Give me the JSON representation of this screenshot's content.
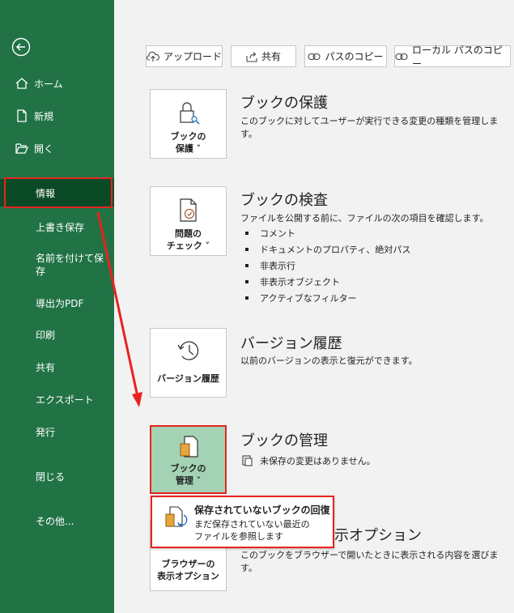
{
  "sidebar": {
    "items": [
      {
        "label": "ホーム",
        "icon": "home-icon"
      },
      {
        "label": "新規",
        "icon": "new-file-icon"
      },
      {
        "label": "開く",
        "icon": "folder-open-icon"
      },
      {
        "label": "情報",
        "selected": true
      },
      {
        "label": "上書き保存"
      },
      {
        "label": "名前を付けて保存"
      },
      {
        "label": "導出为PDF"
      },
      {
        "label": "印刷"
      },
      {
        "label": "共有"
      },
      {
        "label": "エクスポート"
      },
      {
        "label": "発行"
      },
      {
        "label": "閉じる"
      },
      {
        "label": "その他..."
      }
    ]
  },
  "toolbar": {
    "upload": "アップロード",
    "share": "共有",
    "copy_path": "パスのコピー",
    "copy_local_path": "ローカル パスのコピー"
  },
  "protect": {
    "tile_line1": "ブックの",
    "tile_line2": "保護 ˅",
    "title": "ブックの保護",
    "desc": "このブックに対してユーザーが実行できる変更の種類を管理します。"
  },
  "inspect": {
    "tile_line1": "問題の",
    "tile_line2": "チェック ˅",
    "title": "ブックの検査",
    "desc": "ファイルを公開する前に、ファイルの次の項目を確認します。",
    "bullets": [
      "コメント",
      "ドキュメントのプロパティ、絶対パス",
      "非表示行",
      "非表示オブジェクト",
      "アクティブなフィルター"
    ]
  },
  "version": {
    "tile_line1": "バージョン履歴",
    "title": "バージョン履歴",
    "desc": "以前のバージョンの表示と復元ができます。"
  },
  "manage": {
    "tile_line1": "ブックの",
    "tile_line2": "管理 ˅",
    "title": "ブックの管理",
    "status": "未保存の変更はありません。"
  },
  "browser": {
    "tile_line1": "ブラウザーの",
    "tile_line2": "表示オプション",
    "title_visible": "示オプション",
    "desc": "このブックをブラウザーで開いたときに表示される内容を選びます。"
  },
  "popup": {
    "title": "保存されていないブックの回復",
    "desc_line1": "まだ保存されていない最近の",
    "desc_line2": "ファイルを参照します"
  },
  "colors": {
    "sidebar": "#217346",
    "selected": "#0b4a26",
    "highlight": "#e8231f",
    "manage_tile": "#a3d3b4"
  }
}
